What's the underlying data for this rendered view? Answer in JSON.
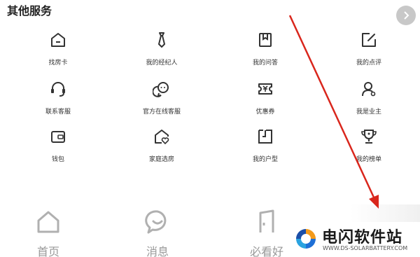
{
  "section": {
    "title": "其他服务"
  },
  "services": [
    {
      "label": "找房卡",
      "icon": "house-card-icon"
    },
    {
      "label": "我的经纪人",
      "icon": "tie-agent-icon"
    },
    {
      "label": "我的问答",
      "icon": "bookmark-qa-icon"
    },
    {
      "label": "我的点评",
      "icon": "edit-review-icon"
    },
    {
      "label": "联系客服",
      "icon": "headset-icon"
    },
    {
      "label": "官方在线客服",
      "icon": "chat-bubbles-icon"
    },
    {
      "label": "优惠券",
      "icon": "coupon-icon"
    },
    {
      "label": "我是业主",
      "icon": "owner-person-icon"
    },
    {
      "label": "钱包",
      "icon": "wallet-icon"
    },
    {
      "label": "家庭选房",
      "icon": "family-house-heart-icon"
    },
    {
      "label": "我的户型",
      "icon": "floorplan-icon"
    },
    {
      "label": "我的榜单",
      "icon": "trophy-icon"
    }
  ],
  "tabbar": [
    {
      "label": "首页",
      "icon": "home-icon"
    },
    {
      "label": "消息",
      "icon": "message-icon"
    },
    {
      "label": "必看好",
      "icon": "door-icon"
    }
  ],
  "watermark": {
    "title": "电闪软件站",
    "subtitle": "WWW.DS-SOLARBATTERY.COM"
  },
  "colors": {
    "arrow": "#d9261c",
    "tab_text": "#999999",
    "icon_stroke": "#333333"
  }
}
